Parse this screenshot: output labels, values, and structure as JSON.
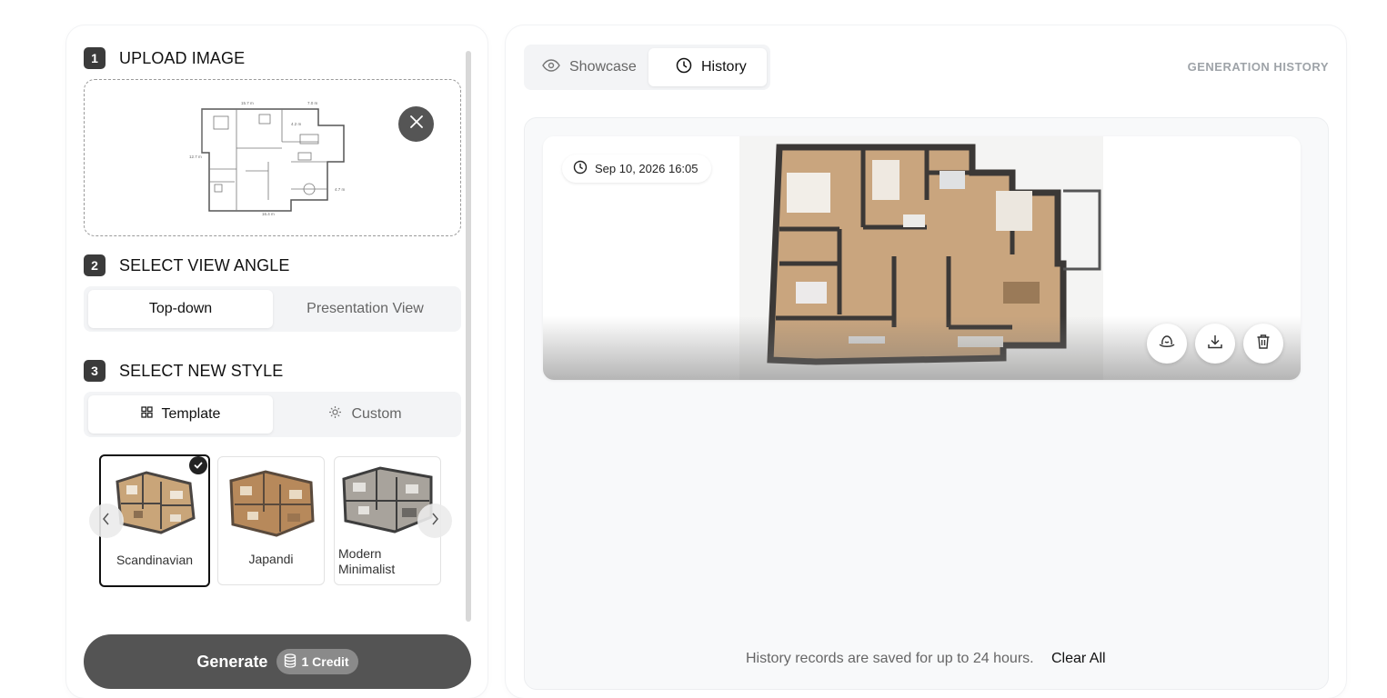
{
  "steps": [
    {
      "num": "1",
      "title": "UPLOAD IMAGE"
    },
    {
      "num": "2",
      "title": "SELECT VIEW ANGLE"
    },
    {
      "num": "3",
      "title": "SELECT NEW STYLE"
    }
  ],
  "view_angle": {
    "options": [
      "Top-down",
      "Presentation View"
    ],
    "selected": "Top-down"
  },
  "style_mode": {
    "options": [
      "Template",
      "Custom"
    ],
    "selected": "Template"
  },
  "templates": [
    {
      "label": "Scandinavian",
      "selected": true
    },
    {
      "label": "Japandi",
      "selected": false
    },
    {
      "label": "Modern Minimalist",
      "selected": false
    }
  ],
  "generate": {
    "label": "Generate",
    "credit": "1 Credit"
  },
  "tabs": {
    "showcase": "Showcase",
    "history": "History",
    "active": "History"
  },
  "panel_title": "GENERATION HISTORY",
  "history": [
    {
      "timestamp": "Sep 10, 2026 16:05"
    }
  ],
  "footer": {
    "note": "History records are saved for up to 24 hours.",
    "clear_all": "Clear All"
  },
  "icons": {
    "remove": "close-icon",
    "showcase": "eye-icon",
    "history": "clock-icon",
    "template": "grid-icon",
    "custom": "sun-sparkle-icon",
    "credit": "database-icon",
    "watermark": "hat-icon",
    "download": "download-icon",
    "delete": "trash-icon"
  },
  "colors": {
    "accent": "#3b3b3b",
    "generate_bg": "#545454",
    "panel_bg": "#f8f9fa"
  }
}
